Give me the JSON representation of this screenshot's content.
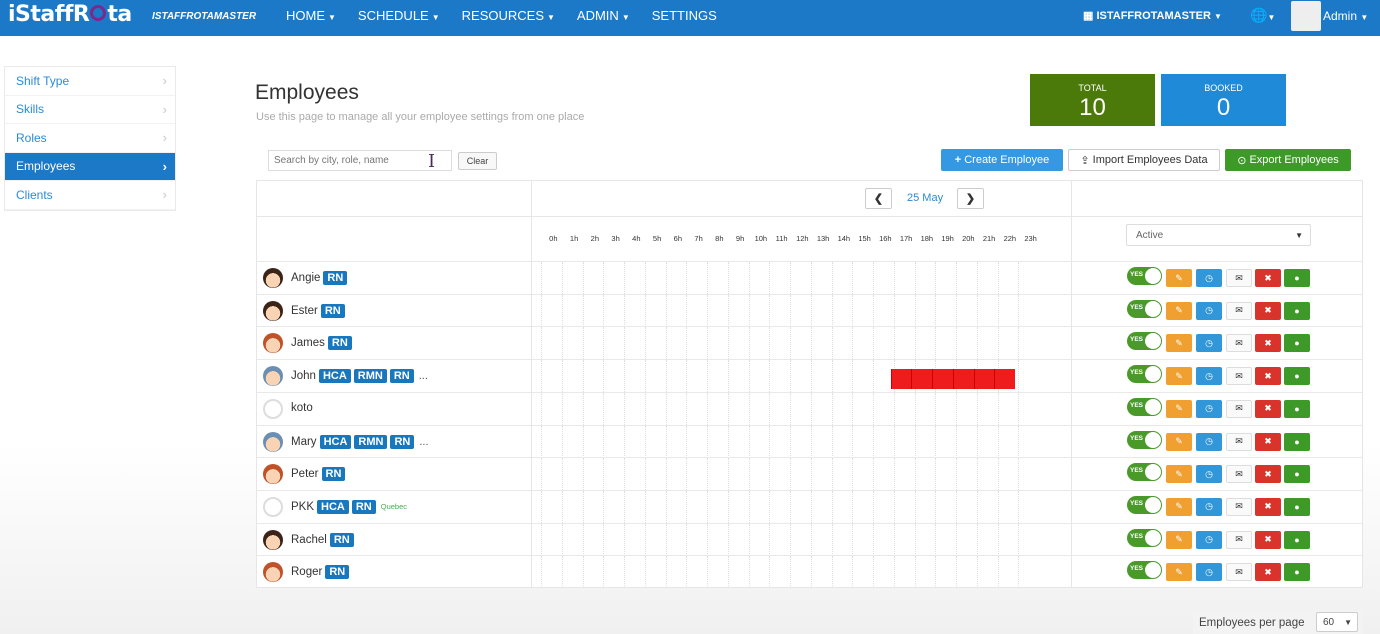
{
  "app": {
    "logo": "iStaffRota",
    "org_brand": "ISTAFFROTAMASTER"
  },
  "nav": {
    "items": [
      {
        "label": "HOME",
        "caret": true
      },
      {
        "label": "SCHEDULE",
        "caret": true
      },
      {
        "label": "RESOURCES",
        "caret": true
      },
      {
        "label": "ADMIN",
        "caret": true
      },
      {
        "label": "SETTINGS",
        "caret": false
      }
    ],
    "org_menu": "ISTAFFROTAMASTER",
    "user_menu": "Admin"
  },
  "sidebar": {
    "items": [
      {
        "label": "Shift Type",
        "active": false
      },
      {
        "label": "Skills",
        "active": false
      },
      {
        "label": "Roles",
        "active": false
      },
      {
        "label": "Employees",
        "active": true
      },
      {
        "label": "Clients",
        "active": false
      }
    ]
  },
  "header": {
    "title": "Employees",
    "subtitle": "Use this page to manage all your employee settings from one place"
  },
  "stats": {
    "total_label": "TOTAL",
    "total_value": "10",
    "booked_label": "BOOKED",
    "booked_value": "0"
  },
  "toolbar": {
    "search_placeholder": "Search by city, role, name",
    "clear_label": "Clear",
    "create_label": "Create Employee",
    "import_label": "Import Employees Data",
    "export_label": "Export Employees"
  },
  "schedule": {
    "date": "25 May",
    "hours": [
      "0h",
      "1h",
      "2h",
      "3h",
      "4h",
      "5h",
      "6h",
      "7h",
      "8h",
      "9h",
      "10h",
      "11h",
      "12h",
      "13h",
      "14h",
      "15h",
      "16h",
      "17h",
      "18h",
      "19h",
      "20h",
      "21h",
      "22h",
      "23h"
    ],
    "status_filter": "Active"
  },
  "employees": [
    {
      "name": "Angie",
      "badges": [
        "RN"
      ],
      "more": false,
      "location": "",
      "face": "female",
      "booking_hours": []
    },
    {
      "name": "Ester",
      "badges": [
        "RN"
      ],
      "more": false,
      "location": "",
      "face": "female",
      "booking_hours": []
    },
    {
      "name": "James",
      "badges": [
        "RN"
      ],
      "more": false,
      "location": "",
      "face": "male",
      "booking_hours": []
    },
    {
      "name": "John",
      "badges": [
        "HCA",
        "RMN",
        "RN"
      ],
      "more": true,
      "location": "",
      "face": "male-blue",
      "booking_hours": [
        18,
        19,
        20,
        21,
        22,
        23
      ]
    },
    {
      "name": "koto",
      "badges": [],
      "more": false,
      "location": "",
      "face": "none",
      "booking_hours": []
    },
    {
      "name": "Mary",
      "badges": [
        "HCA",
        "RMN",
        "RN"
      ],
      "more": true,
      "location": "",
      "face": "male-blue",
      "booking_hours": []
    },
    {
      "name": "Peter",
      "badges": [
        "RN"
      ],
      "more": false,
      "location": "",
      "face": "male",
      "booking_hours": []
    },
    {
      "name": "PKK",
      "badges": [
        "HCA",
        "RN"
      ],
      "more": false,
      "location": "Quebec",
      "face": "none",
      "booking_hours": []
    },
    {
      "name": "Rachel",
      "badges": [
        "RN"
      ],
      "more": false,
      "location": "",
      "face": "female",
      "booking_hours": []
    },
    {
      "name": "Roger",
      "badges": [
        "RN"
      ],
      "more": false,
      "location": "",
      "face": "male",
      "booking_hours": []
    }
  ],
  "row_controls": {
    "toggle_label": "YES",
    "ellipsis": "..."
  },
  "pagination": {
    "per_page_label": "Employees per page",
    "per_page_value": "60"
  },
  "colors": {
    "primary": "#1c79c8",
    "total_bg": "#4b7a0b",
    "booked_bg": "#1e8ad8",
    "booking": "#ee1c1c",
    "badge": "#1877bd"
  }
}
